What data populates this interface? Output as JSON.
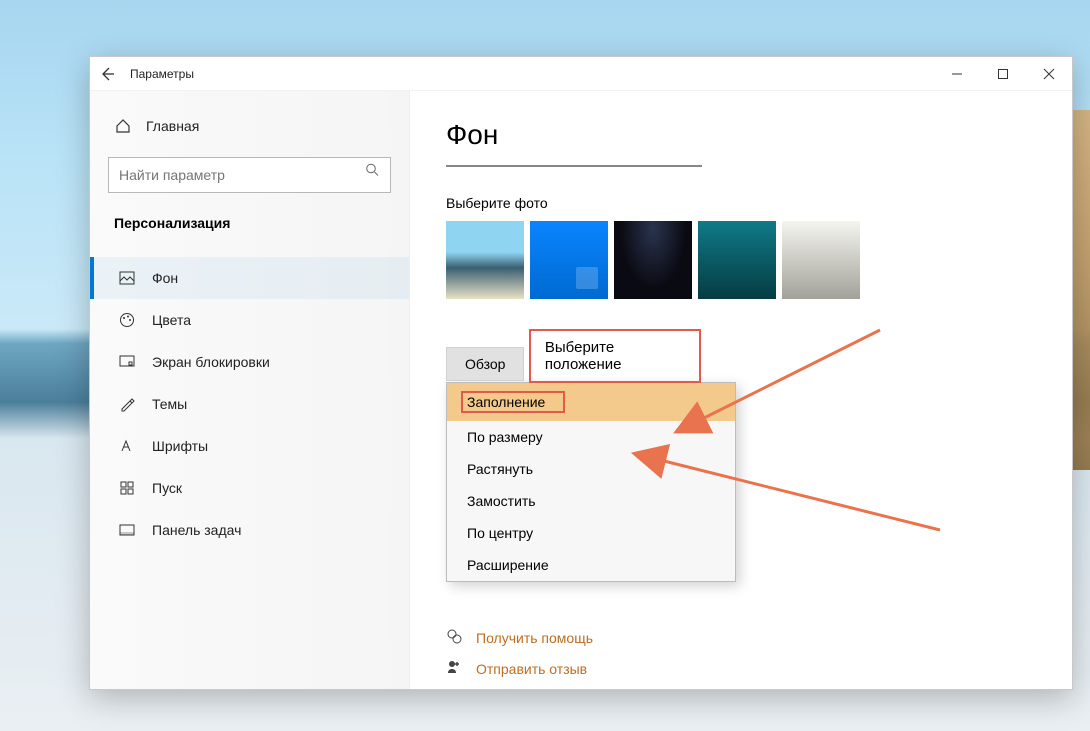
{
  "titlebar": {
    "title": "Параметры"
  },
  "sidebar": {
    "home_label": "Главная",
    "search_placeholder": "Найти параметр",
    "section_title": "Персонализация",
    "items": [
      {
        "label": "Фон"
      },
      {
        "label": "Цвета"
      },
      {
        "label": "Экран блокировки"
      },
      {
        "label": "Темы"
      },
      {
        "label": "Шрифты"
      },
      {
        "label": "Пуск"
      },
      {
        "label": "Панель задач"
      }
    ]
  },
  "main": {
    "page_title": "Фон",
    "choose_photo_label": "Выберите фото",
    "browse_label": "Обзор",
    "choose_position_label": "Выберите положение",
    "position_options": [
      "Заполнение",
      "По размеру",
      "Растянуть",
      "Замостить",
      "По центру",
      "Расширение"
    ],
    "help_link": "Получить помощь",
    "feedback_link": "Отправить отзыв"
  }
}
